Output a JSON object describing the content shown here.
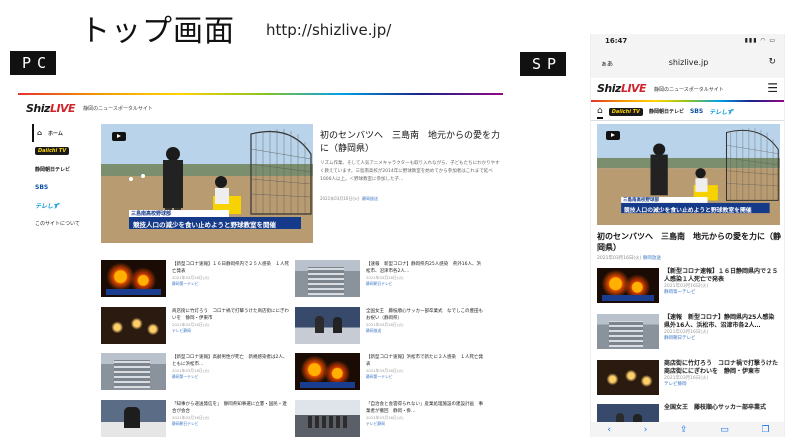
{
  "slide": {
    "title": "トップ画面",
    "url": "http://shizlive.jp/",
    "pc_tag": "PC",
    "sp_tag": "SP"
  },
  "brand": {
    "logo_main": "Shiz",
    "logo_accent": "LIVE",
    "tagline": "静岡のニュースポータルサイト",
    "accent_color": "#d2232a"
  },
  "sidebar": {
    "items": [
      {
        "label": "ホーム",
        "icon": "home-icon"
      },
      {
        "label": "Daiichi TV",
        "icon": "daiichi-logo"
      },
      {
        "label": "静岡朝日テレビ",
        "icon": "sateve-logo"
      },
      {
        "label": "SBS",
        "icon": "sbs-logo"
      },
      {
        "label": "テレしず",
        "icon": "sut-logo"
      },
      {
        "label": "このサイトについて",
        "icon": ""
      }
    ]
  },
  "hero": {
    "title": "初のセンバツへ　三島南　地元からの愛を力に（静岡県）",
    "body": "リズム作業、そして人気アニメキャラクターも取り入れながら、子どもたちにわかりやすく教えています。三島南高校が2014年に野球教室を始めてから参加者はこれまで延べ1000人以上。＜野球教室に参加した子…",
    "date": "2021年03月16日(火)",
    "source": "静岡放送",
    "caption_top": "三島南高校野球部",
    "caption_main": "競技人口の減少を食い止めようと野球教室を開催"
  },
  "pc_news": [
    {
      "title": "【新型コロナ速報】１６日静岡県内で２５人感染　１人死亡発表",
      "date": "2021年03月16日(火)",
      "source": "静岡第一テレビ"
    },
    {
      "title": "【速報　新型コロナ】静岡県内25人感染　県外16人、浜松市、沼津市各2人…",
      "date": "2021年03月16日(火)",
      "source": "静岡朝日テレビ"
    },
    {
      "title": "商店街に竹灯ろう　コロナ禍で打撃うけた商店街ににぎわいを　静岡・伊東市",
      "date": "2021年03月16日(火)",
      "source": "テレビ静岡"
    },
    {
      "title": "全国女王　藤枝順心サッカー部卒業式　なでしこの豊田もお祝い（静岡県）",
      "date": "2021年03月16日(火)",
      "source": "静岡放送"
    },
    {
      "title": "【新型コロナ速報】高齢男性が死亡　新規感染者は2人、ともに浜松市…",
      "date": "2021年03月16日(火)",
      "source": "静岡第一テレビ"
    },
    {
      "title": "【新型コロナ速報】浜松市で新たに２人感染　１人死亡発表",
      "date": "2021年03月16日(火)",
      "source": "静岡第一テレビ"
    },
    {
      "title": "「知事から递送発信を」　静岡県知事選に立憲・国民・連合が会合",
      "date": "2021年03月16日(火)",
      "source": "静岡朝日テレビ"
    },
    {
      "title": "「自治会と会雲得られない」産業処理施設の建設計画　事業者が撤回　静岡・掛…",
      "date": "2021年03月16日(火)",
      "source": "テレビ静岡"
    }
  ],
  "sp": {
    "time": "16:47",
    "status_icons": "▮▮▮ ◠ ▭",
    "aa": "ぁあ",
    "address": "shizlive.jp",
    "hero_title": "初のセンバツへ　三島南　地元からの愛を力に（静岡県）",
    "hero_date": "2021年03月16日(火)",
    "hero_source": "静岡放送",
    "tabs": [
      {
        "label": "ホーム"
      },
      {
        "label": "Daiichi TV"
      },
      {
        "label": "静岡朝日テレビ"
      },
      {
        "label": "SBS"
      },
      {
        "label": "テレしず"
      }
    ],
    "news": [
      {
        "title": "【新型コロナ速報】１６日静岡県内で２５人感染１人死亡で発表",
        "date": "2021年03月16日(火)",
        "source": "静岡第一テレビ"
      },
      {
        "title": "【速報　新型コロナ】静岡県内25人感染　県外16人、浜松市、沼津市各2人…",
        "date": "2021年03月16日(火)",
        "source": "静岡朝日テレビ"
      },
      {
        "title": "商店街に竹灯ろう　コロナ禍で打撃うけた商店街ににぎわいを　静岡・伊東市",
        "date": "2021年03月16日(火)",
        "source": "テレビ静岡"
      },
      {
        "title": "全国女王　藤枝順心サッカー部卒業式",
        "date": "",
        "source": ""
      }
    ]
  }
}
